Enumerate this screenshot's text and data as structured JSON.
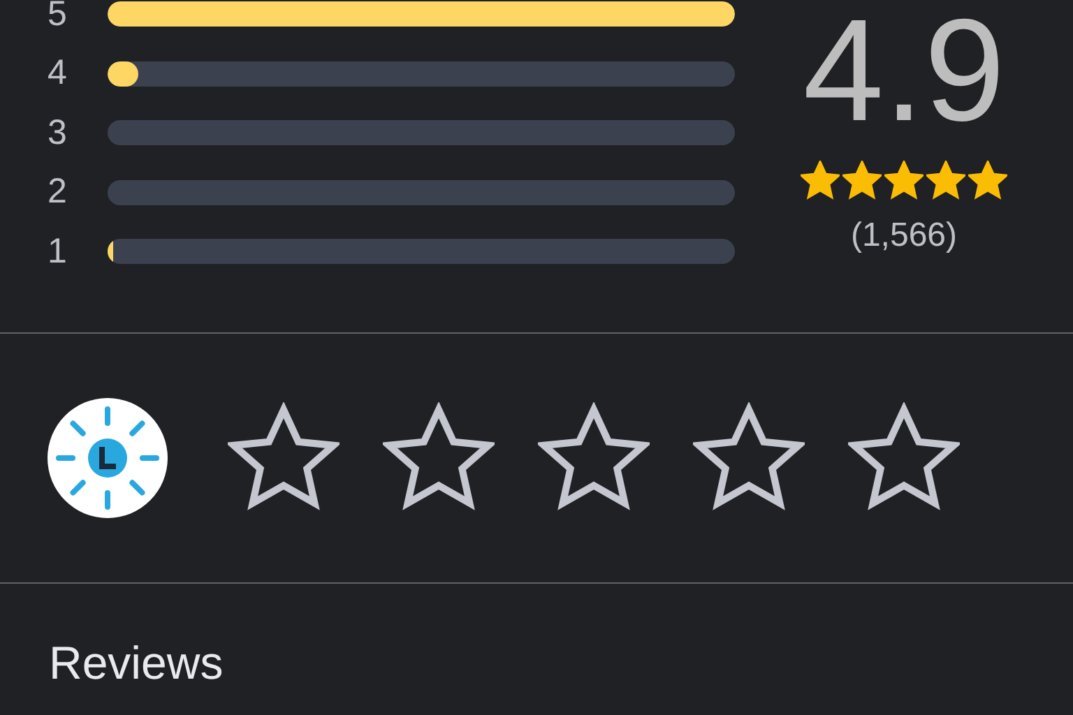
{
  "histogram": [
    {
      "label": "5",
      "level": 1.0
    },
    {
      "label": "4",
      "level": 0.05
    },
    {
      "label": "3"
    },
    {
      "label": "2"
    },
    {
      "label": "1",
      "level": 0.01
    }
  ],
  "summary": {
    "score": "4.9",
    "stars": 5,
    "count": "(1,566)"
  },
  "rate": {
    "stars": 0
  },
  "section_title": "Reviews"
}
